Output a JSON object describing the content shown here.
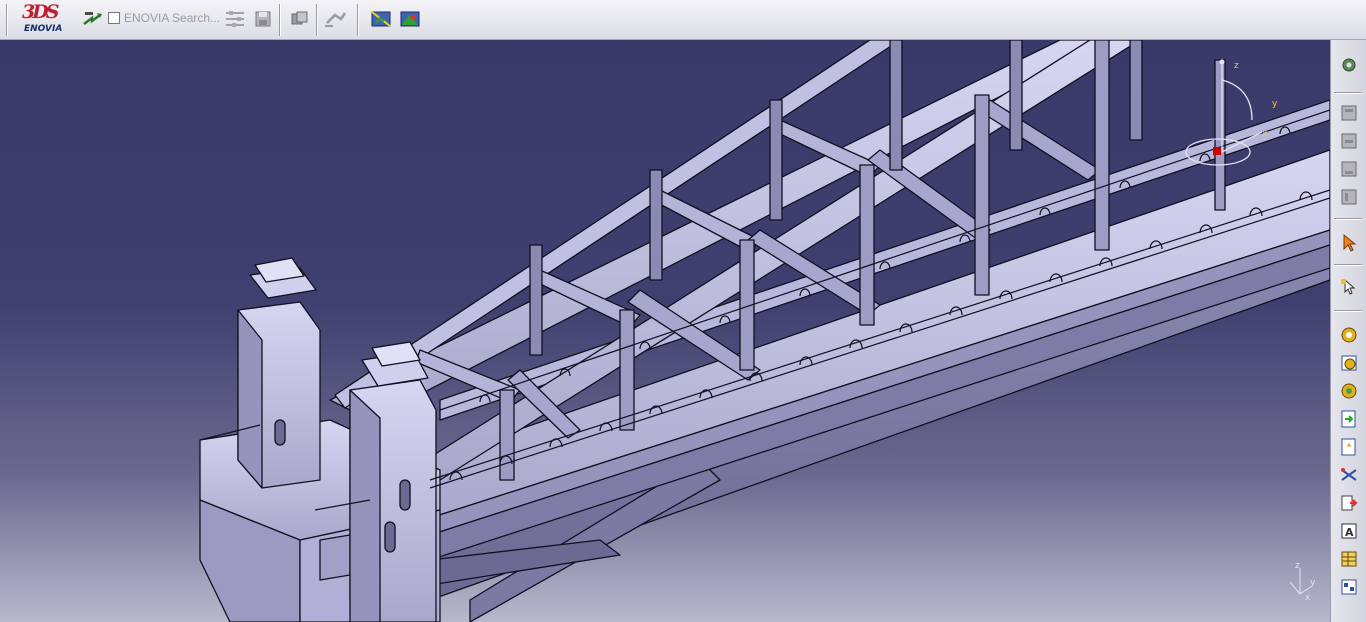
{
  "toolbar": {
    "logo": {
      "mark": "3DS",
      "text": "ENOVIA"
    },
    "search": {
      "text": "ENOVIA Search..."
    }
  },
  "compass": {
    "x": "x",
    "y": "y",
    "z": "z"
  },
  "axis_triad": {
    "x": "x",
    "y": "y",
    "z": "z"
  },
  "icons": {
    "top": [
      "enovia-logo-icon",
      "navigate-icon",
      "search-options-icon",
      "save-icon",
      "layers-icon",
      "relation-icon",
      "swap-view-icon",
      "render-style-icon"
    ],
    "right": [
      "gear-settings-icon",
      "tree-1-icon",
      "tree-2-icon",
      "tree-3-icon",
      "tree-4-icon",
      "select-arrow-icon",
      "select-cursor-icon",
      "gear-yellow-icon",
      "gear-blue-icon",
      "gear-green-icon",
      "doc-arrow-icon",
      "doc-star-icon",
      "measure-icon",
      "list-arrow-icon",
      "text-box-icon",
      "table-icon",
      "group-icon"
    ]
  },
  "colors": {
    "viewport_top": "#3a3a6a",
    "model_face": "#c8c8e8",
    "model_edge": "#101020",
    "accent_red": "#cc0000"
  }
}
